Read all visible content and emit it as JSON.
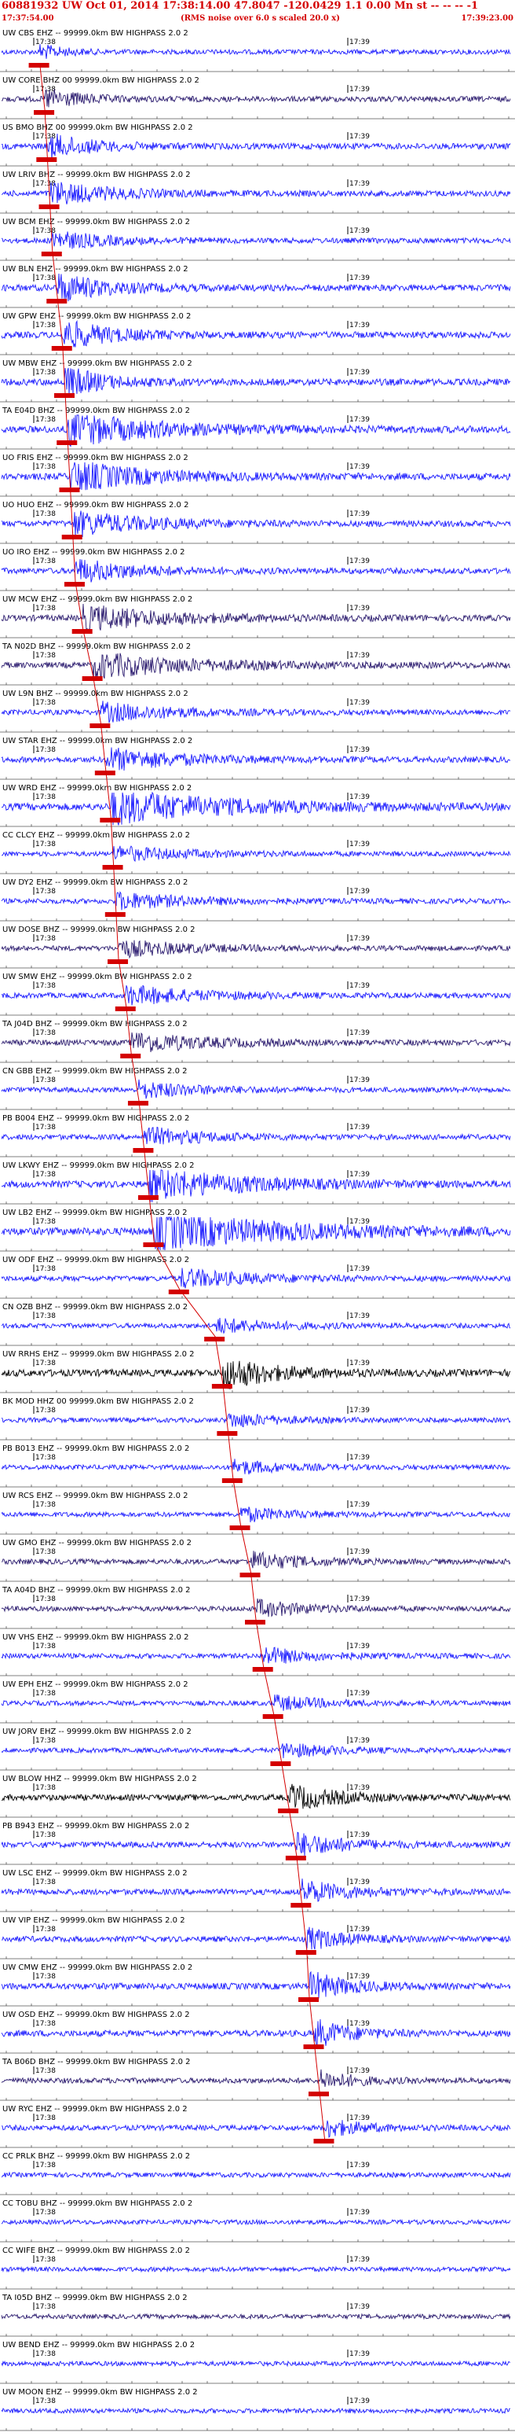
{
  "header": {
    "title": "60881932 UW Oct 01, 2014 17:38:14.00 47.8047 -120.0429 1.1 0.00 Mn st -- -- -- -1",
    "start_time": "17:37:54.00",
    "subtitle": "(RMS noise over 6.0 s scaled 20.0 x)",
    "end_time": "17:39:23.00"
  },
  "chart_data": {
    "type": "line",
    "title": "60881932 UW Oct 01, 2014 17:38:14.00 47.8047 -120.0429 1.1 0.00 Mn st -- -- -- -1",
    "x_range": [
      "17:37:54.00",
      "17:39:23.00"
    ],
    "minute_tick_labels": [
      "17:38",
      "17:39"
    ],
    "grid": false,
    "pick_marker_color": "#d40000",
    "colors": {
      "trace": "#1a1aff",
      "dark_trace": "#2a1a6e",
      "black_trace": "#000000",
      "label": "#000000",
      "pick": "#d40000"
    },
    "stations": [
      {
        "label": "UW CBS EHZ -- 99999.0km BW HIGHPASS 2.0 2",
        "pick": 0.075,
        "color": "blue",
        "amp": 0.35,
        "event_dur": 0.1
      },
      {
        "label": "UW CORE BHZ 00 99999.0km BW HIGHPASS 2.0 2",
        "pick": 0.085,
        "color": "dark",
        "amp": 0.5,
        "event_dur": 0.15
      },
      {
        "label": "US BMO BHZ 00 99999.0km BW HIGHPASS 2.0 2",
        "pick": 0.09,
        "color": "blue",
        "amp": 0.6,
        "event_dur": 0.18
      },
      {
        "label": "UW LRIV BHZ -- 99999.0km BW HIGHPASS 2.0 2",
        "pick": 0.095,
        "color": "blue",
        "amp": 0.55,
        "event_dur": 0.25
      },
      {
        "label": "UW BCM EHZ -- 99999.0km BW HIGHPASS 2.0 2",
        "pick": 0.1,
        "color": "blue",
        "amp": 0.45,
        "event_dur": 0.22
      },
      {
        "label": "UW BLN EHZ -- 99999.0km BW HIGHPASS 2.0 2",
        "pick": 0.11,
        "color": "blue",
        "amp": 0.7,
        "event_dur": 0.2
      },
      {
        "label": "UW GPW EHZ -- 99999.0km BW HIGHPASS 2.0 2",
        "pick": 0.12,
        "color": "blue",
        "amp": 0.7,
        "event_dur": 0.2
      },
      {
        "label": "UW MBW EHZ -- 99999.0km BW HIGHPASS 2.0 2",
        "pick": 0.125,
        "color": "blue",
        "amp": 0.75,
        "event_dur": 0.15
      },
      {
        "label": "TA E04D BHZ -- 99999.0km BW HIGHPASS 2.0 2",
        "pick": 0.13,
        "color": "blue",
        "amp": 0.8,
        "event_dur": 0.35
      },
      {
        "label": "UO FRIS EHZ -- 99999.0km BW HIGHPASS 2.0 2",
        "pick": 0.135,
        "color": "blue",
        "amp": 0.75,
        "event_dur": 0.3
      },
      {
        "label": "UO HUO EHZ -- 99999.0km BW HIGHPASS 2.0 2",
        "pick": 0.14,
        "color": "blue",
        "amp": 0.6,
        "event_dur": 0.3
      },
      {
        "label": "UO IRO EHZ -- 99999.0km BW HIGHPASS 2.0 2",
        "pick": 0.145,
        "color": "blue",
        "amp": 0.55,
        "event_dur": 0.25
      },
      {
        "label": "UW MCW EHZ -- 99999.0km BW HIGHPASS 2.0 2",
        "pick": 0.16,
        "color": "dark",
        "amp": 0.6,
        "event_dur": 0.35
      },
      {
        "label": "TA N02D BHZ -- 99999.0km BW HIGHPASS 2.0 2",
        "pick": 0.18,
        "color": "dark",
        "amp": 0.6,
        "event_dur": 0.4
      },
      {
        "label": "UW L9N BHZ -- 99999.0km BW HIGHPASS 2.0 2",
        "pick": 0.195,
        "color": "blue",
        "amp": 0.45,
        "event_dur": 0.3
      },
      {
        "label": "UW STAR EHZ -- 99999.0km BW HIGHPASS 2.0 2",
        "pick": 0.205,
        "color": "blue",
        "amp": 0.55,
        "event_dur": 0.3
      },
      {
        "label": "UW WRD EHZ -- 99999.0km BW HIGHPASS 2.0 2",
        "pick": 0.215,
        "color": "blue",
        "amp": 0.85,
        "event_dur": 0.45
      },
      {
        "label": "CC CLCY EHZ -- 99999.0km BW HIGHPASS 2.0 2",
        "pick": 0.22,
        "color": "blue",
        "amp": 0.35,
        "event_dur": 0.3
      },
      {
        "label": "UW DY2 EHZ -- 99999.0km BW HIGHPASS 2.0 2",
        "pick": 0.225,
        "color": "blue",
        "amp": 0.4,
        "event_dur": 0.3
      },
      {
        "label": "UW DOSE BHZ -- 99999.0km BW HIGHPASS 2.0 2",
        "pick": 0.23,
        "color": "dark",
        "amp": 0.4,
        "event_dur": 0.3
      },
      {
        "label": "UW SMW EHZ -- 99999.0km BW HIGHPASS 2.0 2",
        "pick": 0.245,
        "color": "blue",
        "amp": 0.45,
        "event_dur": 0.3
      },
      {
        "label": "TA J04D BHZ -- 99999.0km BW HIGHPASS 2.0 2",
        "pick": 0.255,
        "color": "dark",
        "amp": 0.5,
        "event_dur": 0.3
      },
      {
        "label": "CN GBB EHZ -- 99999.0km BW HIGHPASS 2.0 2",
        "pick": 0.27,
        "color": "blue",
        "amp": 0.4,
        "event_dur": 0.25
      },
      {
        "label": "PB B004 EHZ -- 99999.0km BW HIGHPASS 2.0 2",
        "pick": 0.28,
        "color": "blue",
        "amp": 0.45,
        "event_dur": 0.25
      },
      {
        "label": "UW LKWY EHZ -- 99999.0km BW HIGHPASS 2.0 2",
        "pick": 0.29,
        "color": "blue",
        "amp": 0.75,
        "event_dur": 0.4
      },
      {
        "label": "UW LB2 EHZ -- 99999.0km BW HIGHPASS 2.0 2",
        "pick": 0.3,
        "color": "blue",
        "amp": 0.9,
        "event_dur": 0.55
      },
      {
        "label": "UW ODF EHZ -- 99999.0km BW HIGHPASS 2.0 2",
        "pick": 0.35,
        "color": "blue",
        "amp": 0.45,
        "event_dur": 0.3
      },
      {
        "label": "CN OZB BHZ -- 99999.0km BW HIGHPASS 2.0 2",
        "pick": 0.42,
        "color": "blue",
        "amp": 0.35,
        "event_dur": 0.25
      },
      {
        "label": "UW RRHS EHZ -- 99999.0km BW HIGHPASS 2.0 2",
        "pick": 0.435,
        "color": "black",
        "amp": 0.8,
        "event_dur": 0.2
      },
      {
        "label": "BK MOD HHZ 00 99999.0km BW HIGHPASS 2.0 2",
        "pick": 0.445,
        "color": "blue",
        "amp": 0.35,
        "event_dur": 0.2
      },
      {
        "label": "PB B013 EHZ -- 99999.0km BW HIGHPASS 2.0 2",
        "pick": 0.455,
        "color": "blue",
        "amp": 0.35,
        "event_dur": 0.2
      },
      {
        "label": "UW RCS EHZ -- 99999.0km BW HIGHPASS 2.0 2",
        "pick": 0.47,
        "color": "blue",
        "amp": 0.35,
        "event_dur": 0.2
      },
      {
        "label": "UW GMO EHZ -- 99999.0km BW HIGHPASS 2.0 2",
        "pick": 0.49,
        "color": "dark",
        "amp": 0.45,
        "event_dur": 0.2
      },
      {
        "label": "TA A04D BHZ -- 99999.0km BW HIGHPASS 2.0 2",
        "pick": 0.5,
        "color": "dark",
        "amp": 0.4,
        "event_dur": 0.2
      },
      {
        "label": "UW VHS EHZ -- 99999.0km BW HIGHPASS 2.0 2",
        "pick": 0.515,
        "color": "blue",
        "amp": 0.4,
        "event_dur": 0.2
      },
      {
        "label": "UW EPH EHZ -- 99999.0km BW HIGHPASS 2.0 2",
        "pick": 0.535,
        "color": "blue",
        "amp": 0.35,
        "event_dur": 0.2
      },
      {
        "label": "UW JORV EHZ -- 99999.0km BW HIGHPASS 2.0 2",
        "pick": 0.55,
        "color": "blue",
        "amp": 0.35,
        "event_dur": 0.2
      },
      {
        "label": "UW BLOW HHZ -- 99999.0km BW HIGHPASS 2.0 2",
        "pick": 0.565,
        "color": "black",
        "amp": 0.6,
        "event_dur": 0.2
      },
      {
        "label": "PB B943 EHZ -- 99999.0km BW HIGHPASS 2.0 2",
        "pick": 0.58,
        "color": "blue",
        "amp": 0.55,
        "event_dur": 0.2
      },
      {
        "label": "UW LSC EHZ -- 99999.0km BW HIGHPASS 2.0 2",
        "pick": 0.59,
        "color": "blue",
        "amp": 0.55,
        "event_dur": 0.2
      },
      {
        "label": "UW VIP EHZ -- 99999.0km BW HIGHPASS 2.0 2",
        "pick": 0.6,
        "color": "blue",
        "amp": 0.55,
        "event_dur": 0.15
      },
      {
        "label": "UW CMW EHZ -- 99999.0km BW HIGHPASS 2.0 2",
        "pick": 0.605,
        "color": "blue",
        "amp": 0.7,
        "event_dur": 0.15
      },
      {
        "label": "UW OSD EHZ -- 99999.0km BW HIGHPASS 2.0 2",
        "pick": 0.615,
        "color": "blue",
        "amp": 0.65,
        "event_dur": 0.15
      },
      {
        "label": "TA B06D BHZ -- 99999.0km BW HIGHPASS 2.0 2",
        "pick": 0.625,
        "color": "dark",
        "amp": 0.45,
        "event_dur": 0.15
      },
      {
        "label": "UW RYC EHZ -- 99999.0km BW HIGHPASS 2.0 2",
        "pick": 0.635,
        "color": "blue",
        "amp": 0.45,
        "event_dur": 0.15
      },
      {
        "label": "CC PRLK BHZ -- 99999.0km BW HIGHPASS 2.0 2",
        "pick": null,
        "color": "blue",
        "amp": 0.35,
        "event_dur": 0
      },
      {
        "label": "CC TOBU BHZ -- 99999.0km BW HIGHPASS 2.0 2",
        "pick": null,
        "color": "blue",
        "amp": 0.3,
        "event_dur": 0
      },
      {
        "label": "CC WIFE BHZ -- 99999.0km BW HIGHPASS 2.0 2",
        "pick": null,
        "color": "blue",
        "amp": 0.3,
        "event_dur": 0
      },
      {
        "label": "TA I05D BHZ -- 99999.0km BW HIGHPASS 2.0 2",
        "pick": null,
        "color": "dark",
        "amp": 0.3,
        "event_dur": 0
      },
      {
        "label": "UW BEND EHZ -- 99999.0km BW HIGHPASS 2.0 2",
        "pick": null,
        "color": "blue",
        "amp": 0.3,
        "event_dur": 0
      },
      {
        "label": "UW MOON EHZ -- 99999.0km BW HIGHPASS 2.0 2",
        "pick": null,
        "color": "blue",
        "amp": 0.3,
        "event_dur": 0
      }
    ]
  }
}
